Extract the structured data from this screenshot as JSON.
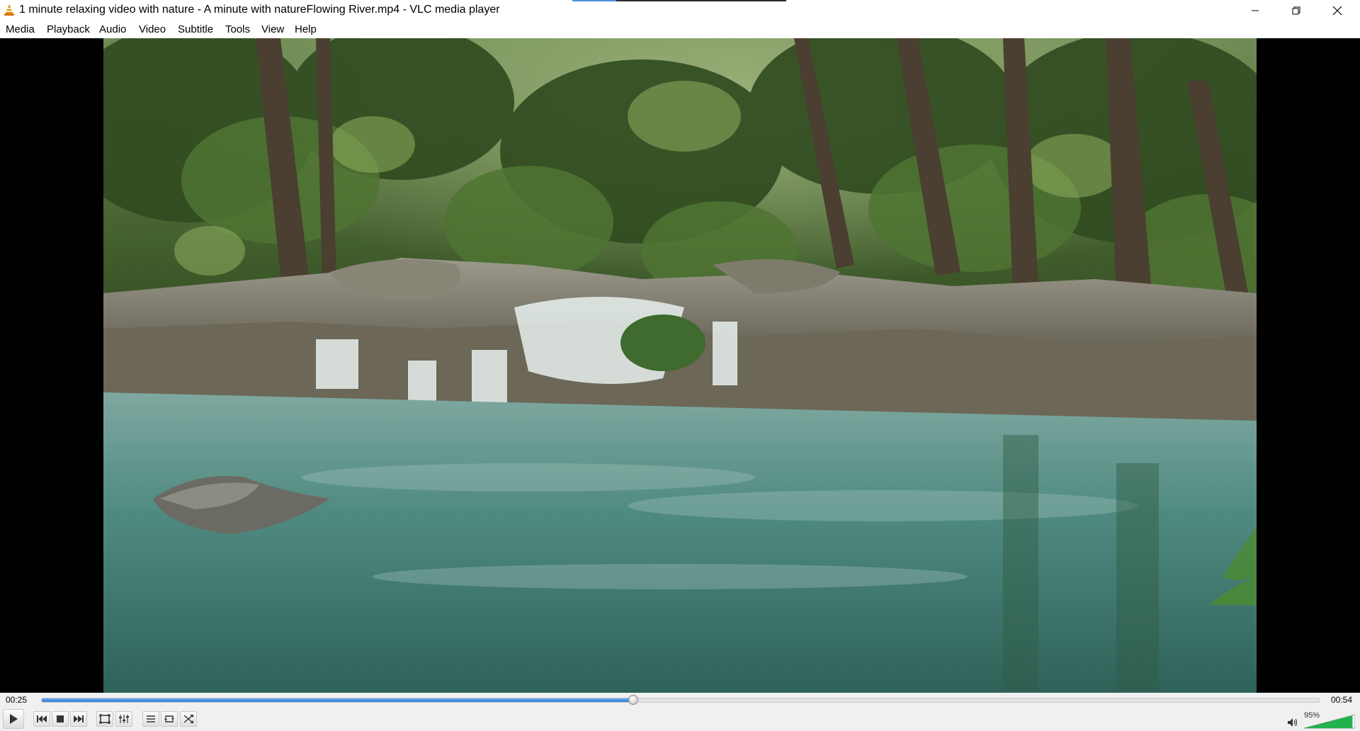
{
  "window": {
    "title": "1 minute relaxing video with nature - A minute with natureFlowing River.mp4 - VLC media player",
    "app_icon": "vlc-cone-icon",
    "buttons": [
      "minimize-icon",
      "restore-icon",
      "close-icon"
    ]
  },
  "menu": {
    "items": [
      "Media",
      "Playback",
      "Audio",
      "Video",
      "Subtitle",
      "Tools",
      "View",
      "Help"
    ]
  },
  "video": {
    "scene": "forest-waterfall-frame"
  },
  "playback": {
    "elapsed": "00:25",
    "total": "00:54",
    "progress": 0.463
  },
  "controls": {
    "icons": [
      "play-icon",
      "previous-icon",
      "stop-icon",
      "next-icon",
      "fullscreen-icon",
      "extended-settings-icon",
      "playlist-icon",
      "loop-icon",
      "shuffle-icon"
    ]
  },
  "volume": {
    "label": "95%",
    "level": 0.95,
    "icon": "speaker-icon"
  },
  "colors": {
    "progress_fill": "#2f7fd6",
    "volume_fill": "#22b14c",
    "vlc_orange": "#f08a00"
  }
}
